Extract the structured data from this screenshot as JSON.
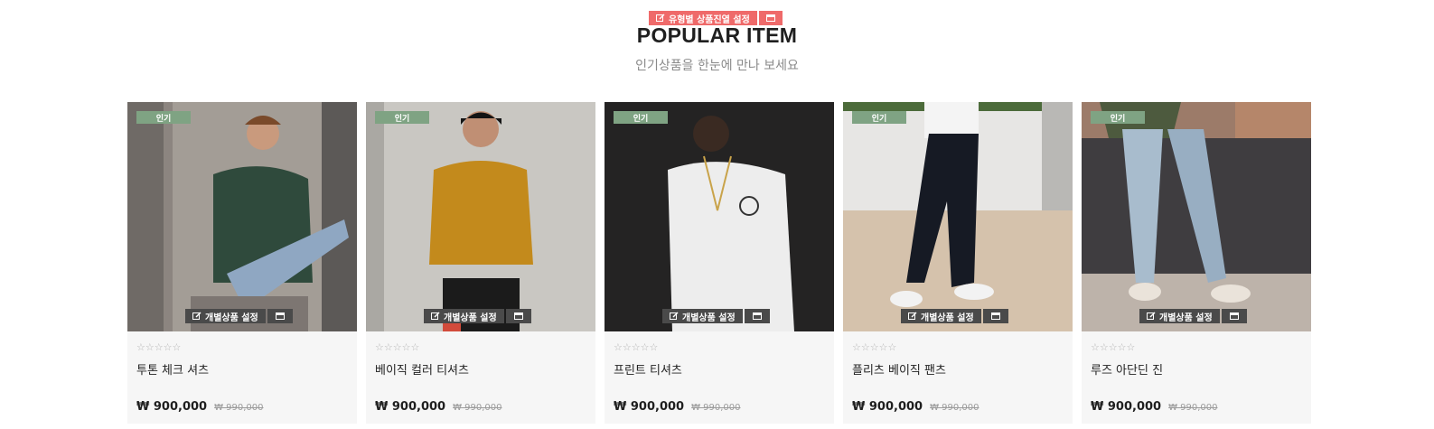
{
  "section": {
    "edit_label": "유형별 상품진열 설정",
    "title": "POPULAR ITEM",
    "subtitle": "인기상품을 한눈에 만나 보세요"
  },
  "colors": {
    "section_edit_bg": "#ef6a6a",
    "badge_bg": "#7fa383",
    "item_edit_bg": "#4a4a4a"
  },
  "products": [
    {
      "badge": "인기",
      "edit_label": "개별상품 설정",
      "rating_stars": "☆☆☆☆☆",
      "name": "투톤 체크 셔츠",
      "price": "₩ 900,000",
      "original_price": "₩ 990,000"
    },
    {
      "badge": "인기",
      "edit_label": "개별상품 설정",
      "rating_stars": "☆☆☆☆☆",
      "name": "베이직 컬러 티셔츠",
      "price": "₩ 900,000",
      "original_price": "₩ 990,000"
    },
    {
      "badge": "인기",
      "edit_label": "개별상품 설정",
      "rating_stars": "☆☆☆☆☆",
      "name": "프린트 티셔츠",
      "price": "₩ 900,000",
      "original_price": "₩ 990,000"
    },
    {
      "badge": "인기",
      "edit_label": "개별상품 설정",
      "rating_stars": "☆☆☆☆☆",
      "name": "플리츠 베이직 팬츠",
      "price": "₩ 900,000",
      "original_price": "₩ 990,000"
    },
    {
      "badge": "인기",
      "edit_label": "개별상품 설정",
      "rating_stars": "☆☆☆☆☆",
      "name": "루즈 아단딘 진",
      "price": "₩ 900,000",
      "original_price": "₩ 990,000"
    }
  ]
}
